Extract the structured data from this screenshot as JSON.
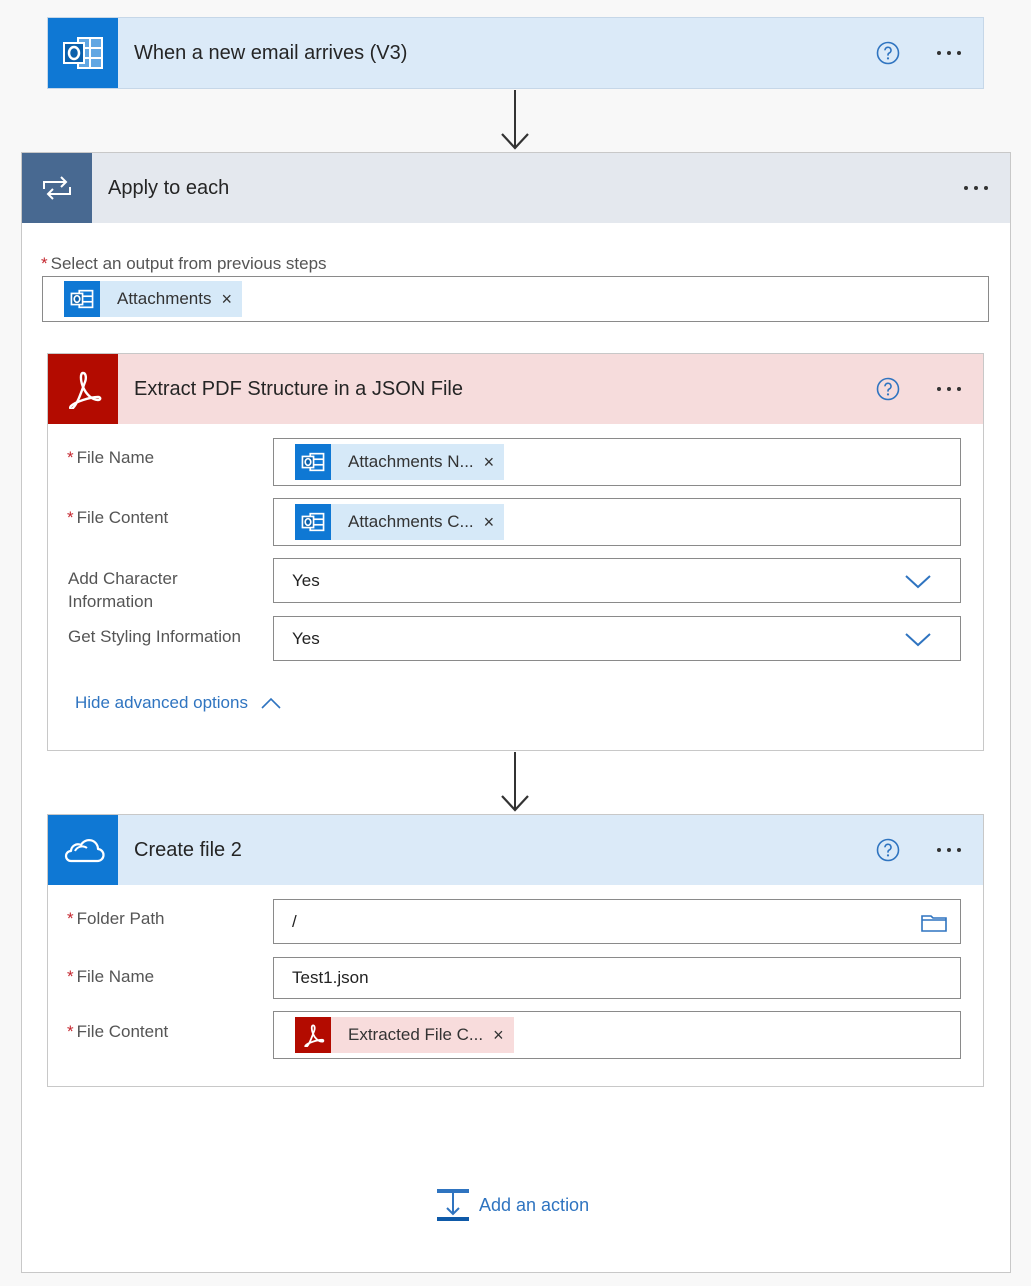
{
  "trigger": {
    "title": "When a new email arrives (V3)",
    "help_icon": "help-circle-icon",
    "more_icon": "more-dots-icon",
    "connector_icon": "outlook-icon"
  },
  "loop": {
    "title": "Apply to each",
    "icon": "loop-icon",
    "select_label": "Select an output from previous steps",
    "select_token": "Attachments",
    "required_mark": "*"
  },
  "extract": {
    "title": "Extract PDF Structure in a JSON File",
    "icon": "adobe-pdf-icon",
    "fields": {
      "file_name": {
        "label": "File Name",
        "token": "Attachments N..."
      },
      "file_content": {
        "label": "File Content",
        "token": "Attachments C..."
      },
      "add_char": {
        "label": "Add Character Information",
        "value": "Yes"
      },
      "styling": {
        "label": "Get Styling Information",
        "value": "Yes"
      }
    },
    "advanced_link": "Hide advanced options"
  },
  "create": {
    "title": "Create file 2",
    "icon": "onedrive-icon",
    "fields": {
      "folder_path": {
        "label": "Folder Path",
        "value": "/"
      },
      "file_name": {
        "label": "File Name",
        "value": "Test1.json"
      },
      "file_content": {
        "label": "File Content",
        "token": "Extracted File C..."
      }
    }
  },
  "add_action": {
    "label": "Add an action"
  },
  "colors": {
    "outlook_blue": "#0f78d4",
    "trigger_bg": "#dbeaf8",
    "loop_icon_bg": "#486991",
    "loop_head_bg": "#e4e8ee",
    "adobe_red": "#b30b00",
    "extract_bg": "#f6dcdc",
    "link_blue": "#2f74c0"
  }
}
